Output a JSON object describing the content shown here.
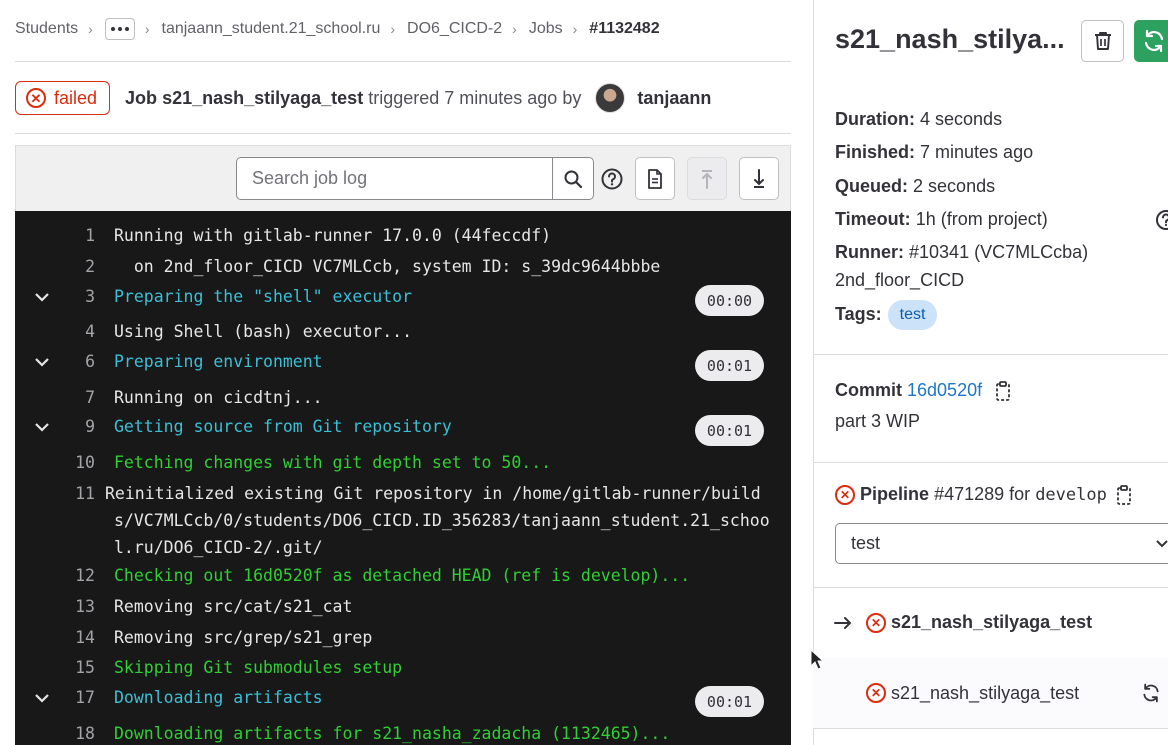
{
  "breadcrumb": {
    "items": [
      "Students",
      "tanjaann_student.21_school.ru",
      "DO6_CICD-2",
      "Jobs"
    ],
    "current": "#1132482"
  },
  "header": {
    "status": "failed",
    "job_prefix": "Job",
    "job_name": "s21_nash_stilyaga_test",
    "triggered_text": "triggered 7 minutes ago by",
    "author": "tanjaann"
  },
  "toolbar": {
    "search_placeholder": "Search job log"
  },
  "log": {
    "lines": [
      {
        "n": "1",
        "text": "Running with gitlab-runner 17.0.0 (44feccdf)"
      },
      {
        "n": "2",
        "text": "  on 2nd_floor_CICD VC7MLCcb, system ID: s_39dc9644bbbe"
      },
      {
        "n": "3",
        "text": "Preparing the \"shell\" executor",
        "duration": "00:00"
      },
      {
        "n": "4",
        "text": "Using Shell (bash) executor..."
      },
      {
        "n": "6",
        "text": "Preparing environment",
        "duration": "00:01"
      },
      {
        "n": "7",
        "text": "Running on cicdtnj..."
      },
      {
        "n": "9",
        "text": "Getting source from Git repository",
        "duration": "00:01"
      },
      {
        "n": "10",
        "text": "Fetching changes with git depth set to 50..."
      },
      {
        "n": "11",
        "text": "Reinitialized existing Git repository in /home/gitlab-runner/builds/VC7MLCcb/0/students/DO6_CICD.ID_356283/tanjaann_student.21_school.ru/DO6_CICD-2/.git/"
      },
      {
        "n": "12",
        "text": "Checking out 16d0520f as detached HEAD (ref is develop)..."
      },
      {
        "n": "13",
        "text": "Removing src/cat/s21_cat"
      },
      {
        "n": "14",
        "text": "Removing src/grep/s21_grep"
      },
      {
        "n": "15",
        "text": "Skipping Git submodules setup"
      },
      {
        "n": "17",
        "text": "Downloading artifacts",
        "duration": "00:01"
      },
      {
        "n": "18",
        "text": "Downloading artifacts for s21_nasha_zadacha (1132465)..."
      }
    ],
    "colors": {
      "section": "#3bbfd6",
      "success": "#2fcf35",
      "default": "#e6e6e6",
      "background": "#181818"
    }
  },
  "sidebar": {
    "title": "s21_nash_stilya...",
    "duration_label": "Duration:",
    "duration": "4 seconds",
    "finished_label": "Finished:",
    "finished": "7 minutes ago",
    "queued_label": "Queued:",
    "queued": "2 seconds",
    "timeout_label": "Timeout:",
    "timeout": "1h (from project)",
    "runner_label": "Runner:",
    "runner": "#10341 (VC7MLCcba)",
    "runner_name": "2nd_floor_CICD",
    "tags_label": "Tags:",
    "tag": "test",
    "commit_label": "Commit",
    "commit_sha": "16d0520f",
    "commit_message": "part 3 WIP",
    "pipeline_label": "Pipeline",
    "pipeline_id": "#471289",
    "pipeline_for": "for",
    "pipeline_ref": "develop",
    "stage": "test",
    "jobs": [
      {
        "name": "s21_nash_stilyaga_test",
        "current": true
      },
      {
        "name": "s21_nash_stilyaga_test",
        "current": false
      }
    ]
  },
  "theme": {
    "danger": "#dd2b0e",
    "retry": "#2da160",
    "link": "#1f75cb"
  }
}
